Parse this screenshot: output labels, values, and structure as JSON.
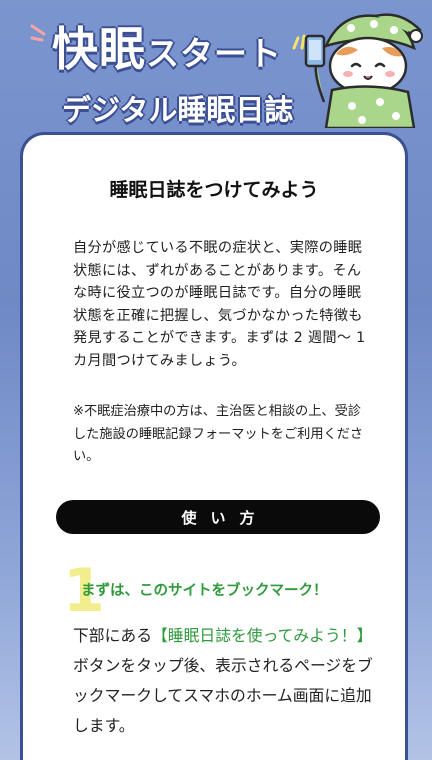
{
  "header": {
    "title_part1": "快眠",
    "title_part2": "スタート",
    "subtitle": "デジタル睡眠日誌"
  },
  "card": {
    "title": "睡眠日誌をつけてみよう",
    "intro": "自分が感じている不眠の症状と、実際の睡眠状態には、ずれがあることがあります。そんな時に役立つのが睡眠日誌です。自分の睡眠状態を正確に把握し、気づかなかった特徴も発見することができます。まずは 2 週間〜 1 カ月間つけてみましょう。",
    "note": "※不眠症治療中の方は、主治医と相談の上、受診した施設の睡眠記録フォーマットをご利用ください。",
    "howto_label": "使い方",
    "step1": {
      "number": "1",
      "title": "まずは、このサイトをブックマーク！",
      "body_pre": "下部にある",
      "body_highlight": "【睡眠日誌を使ってみよう！】",
      "body_post": "ボタンをタップ後、表示されるページをブックマークしてスマホのホーム画面に追加します。"
    }
  },
  "colors": {
    "background": "#7b95cf",
    "outline": "#3c4f93",
    "accent_green": "#2f9a3c",
    "step_number": "#f3ee8d",
    "mascot_pajama": "#a9d68a"
  },
  "icons": [
    "sparkle-lines",
    "mascot-cat-pajama-phone"
  ]
}
